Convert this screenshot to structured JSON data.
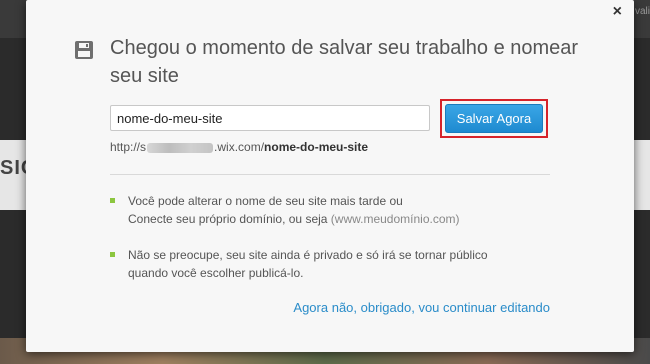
{
  "background": {
    "left_text": "SIC",
    "right_top_text": "vali"
  },
  "modal": {
    "close_glyph": "×",
    "title": "Chegou o momento de salvar seu trabalho e nomear seu site",
    "site_name_value": "nome-do-meu-site",
    "save_button": "Salvar Agora",
    "url_prefix": "http://s",
    "url_middle": ".wix.com/",
    "url_site": "nome-do-meu-site",
    "bullet1_line1": "Você pode alterar o nome de seu site mais tarde ou",
    "bullet1_line2": "Conecte seu próprio domínio, ou seja ",
    "bullet1_domain": "(www.meudomínio.com)",
    "bullet2_line1": "Não se preocupe, seu site ainda é privado e só irá se tornar público",
    "bullet2_line2": "quando você escolher publicá-lo.",
    "later_link": "Agora não, obrigado, vou continuar editando",
    "accent_color": "#2a8cc9",
    "bullet_color": "#8cc63f",
    "highlight_color": "#d6232a",
    "icons": [
      "floppy-disk-icon",
      "close-icon"
    ]
  }
}
